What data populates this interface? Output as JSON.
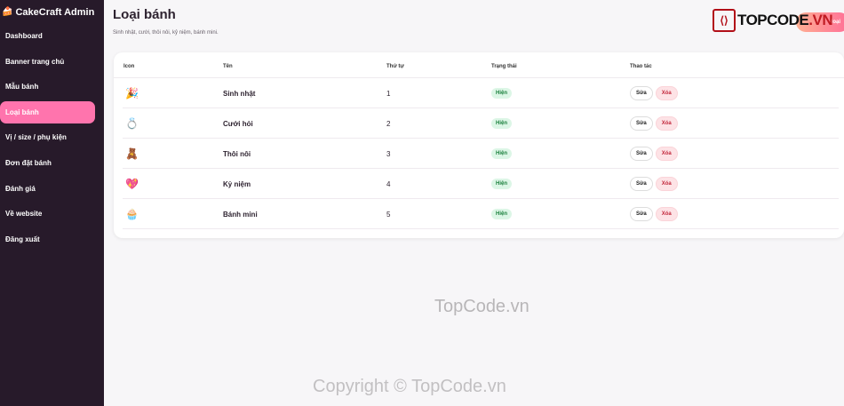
{
  "sidebar": {
    "brand_icon": "🍰",
    "brand": "CakeCraft Admin",
    "items": [
      {
        "label": "Dashboard"
      },
      {
        "label": "Banner trang chủ"
      },
      {
        "label": "Mẫu bánh"
      },
      {
        "label": "Loại bánh",
        "active": true
      },
      {
        "label": "Vị / size / phụ kiện"
      },
      {
        "label": "Đơn đặt bánh"
      },
      {
        "label": "Đánh giá"
      },
      {
        "label": "Về website"
      },
      {
        "label": "Đăng xuất"
      }
    ]
  },
  "header": {
    "title": "Loại bánh",
    "subtitle": "Sinh nhật, cưới, thôi nôi, kỷ niệm, bánh mini.",
    "add_button": "loại"
  },
  "table": {
    "columns": [
      "Icon",
      "Tên",
      "Thứ tự",
      "Trạng thái",
      "Thao tác"
    ],
    "rows": [
      {
        "icon": "🎉",
        "name": "Sinh nhật",
        "order": "1",
        "status": "Hiện"
      },
      {
        "icon": "💍",
        "name": "Cưới hỏi",
        "order": "2",
        "status": "Hiện"
      },
      {
        "icon": "🧸",
        "name": "Thôi nôi",
        "order": "3",
        "status": "Hiện"
      },
      {
        "icon": "💖",
        "name": "Kỷ niệm",
        "order": "4",
        "status": "Hiện"
      },
      {
        "icon": "🧁",
        "name": "Bánh mini",
        "order": "5",
        "status": "Hiện"
      }
    ],
    "edit_label": "Sửa",
    "delete_label": "Xóa"
  },
  "watermark": {
    "logo_text_a": "TOPCODE",
    "logo_text_b": ".VN",
    "center": "TopCode.vn",
    "bottom": "Copyright © TopCode.vn"
  },
  "colors": {
    "sidebar_bg": "#271a2a",
    "accent": "#ff74ad",
    "status_green": "#1a7f3c",
    "danger": "#c2263a"
  }
}
